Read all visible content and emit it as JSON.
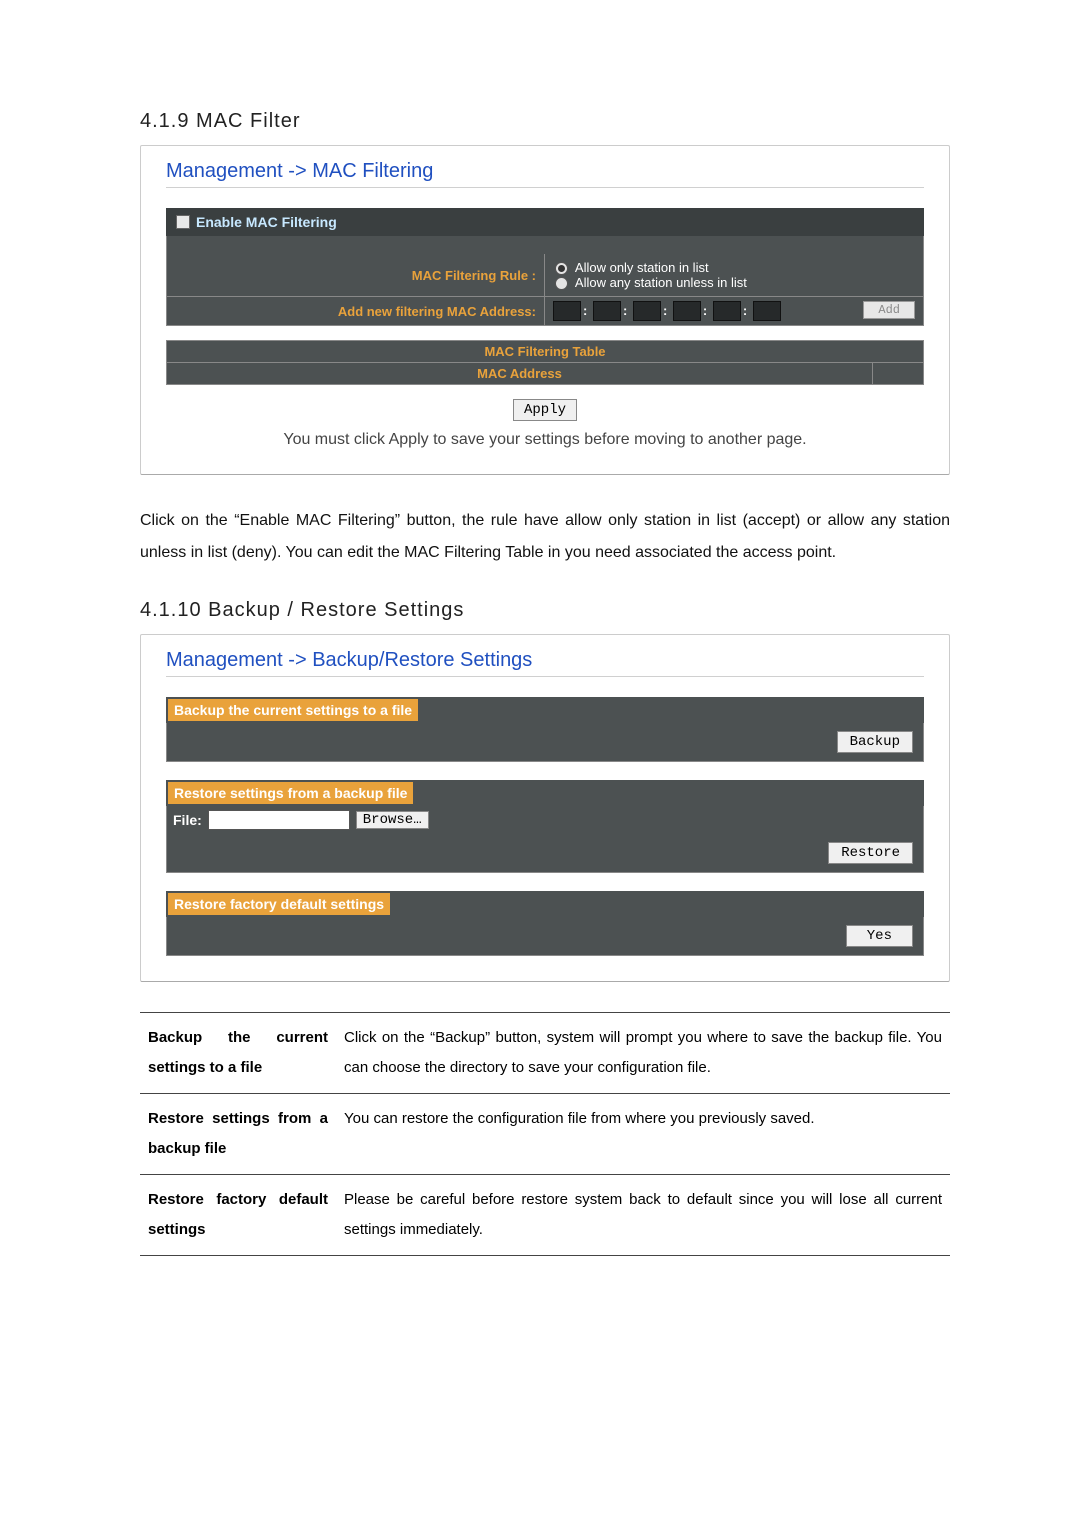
{
  "sections": {
    "macFilter": {
      "heading": "4.1.9 MAC Filter",
      "title": "Management -> MAC Filtering",
      "enableLabel": "Enable MAC Filtering",
      "ruleLabel": "MAC Filtering Rule :",
      "optAllowOnly": "Allow only station in list",
      "optAllowAny": "Allow any station unless in list",
      "addLabel": "Add new filtering MAC Address:",
      "addBtn": "Add",
      "tableHeader": "MAC Filtering Table",
      "tableCol": "MAC Address",
      "applyBtn": "Apply",
      "applyNote": "You must click Apply to save your settings before moving to another page."
    },
    "macFilterParagraph": "Click on the “Enable MAC Filtering” button, the rule have allow only station in list (accept) or allow any station unless in list (deny). You can edit the MAC Filtering Table in you need associated the access point.",
    "backup": {
      "heading": "4.1.10 Backup / Restore Settings",
      "title": "Management -> Backup/Restore Settings",
      "barBackup": "Backup the current settings to a file",
      "btnBackup": "Backup",
      "barRestoreFile": "Restore settings from a backup file",
      "fileLabel": "File:",
      "browseBtn": "Browse…",
      "btnRestore": "Restore",
      "barFactory": "Restore factory default settings",
      "btnYes": "Yes"
    },
    "descTable": [
      {
        "k": "Backup the current settings to a file",
        "v": "Click on the “Backup” button, system will prompt you where to save the backup file. You can choose the directory to save your configuration file."
      },
      {
        "k": "Restore settings from a backup file",
        "v": "You can restore the configuration file from where you previously saved."
      },
      {
        "k": "Restore factory default settings",
        "v": "Please be careful before restore system back to default since you will lose all current settings immediately."
      }
    ]
  }
}
